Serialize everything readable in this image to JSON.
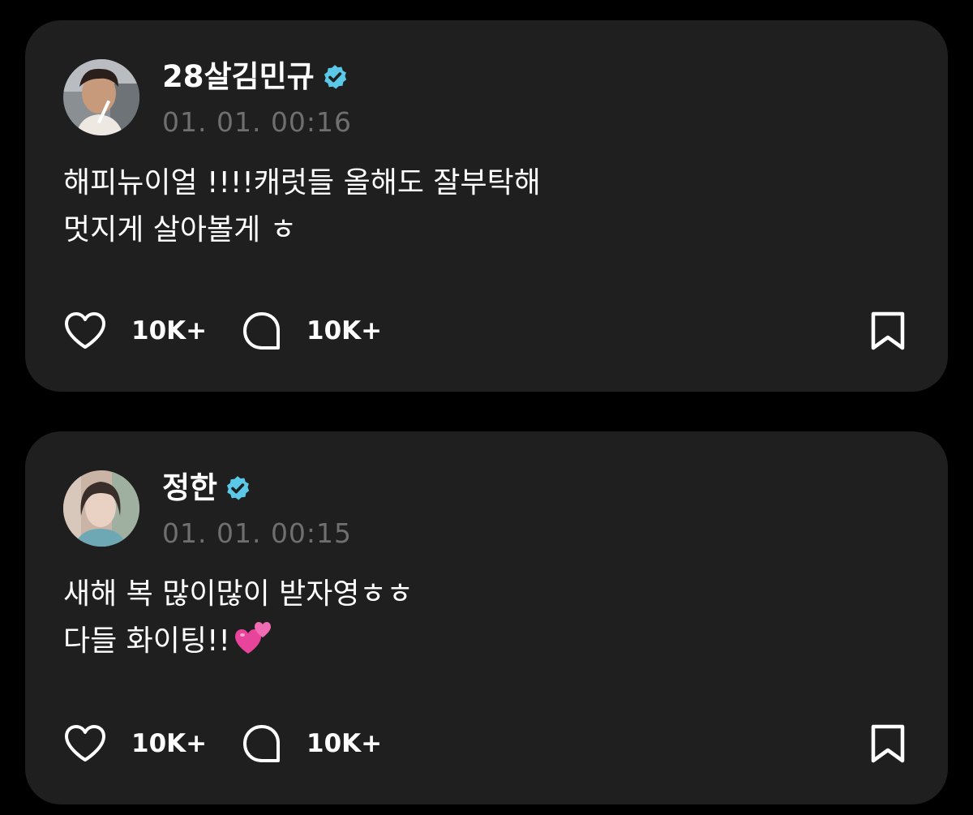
{
  "colors": {
    "background": "#000000",
    "card": "#1f1f1f",
    "text_primary": "#ffffff",
    "text_secondary": "#6f6f6f",
    "verified": "#5bc8e8"
  },
  "posts": [
    {
      "author": "28살김민규",
      "verified": true,
      "time": "01. 01. 00:16",
      "lines": [
        "해피뉴이얼 !!!!캐럿들 올해도 잘부탁해",
        "멋지게 살아볼게 ㅎ"
      ],
      "likes": "10K+",
      "comments": "10K+",
      "icons": [
        "heart-icon",
        "comment-bubble-icon",
        "bookmark-icon",
        "verified-badge-icon"
      ]
    },
    {
      "author": "정한",
      "verified": true,
      "time": "01. 01. 00:15",
      "lines": [
        "새해 복 많이많이 받자영ㅎㅎ",
        "다들 화이팅!!"
      ],
      "likes": "10K+",
      "comments": "10K+",
      "icons": [
        "heart-icon",
        "comment-bubble-icon",
        "bookmark-icon",
        "verified-badge-icon",
        "two-hearts-emoji"
      ]
    }
  ]
}
